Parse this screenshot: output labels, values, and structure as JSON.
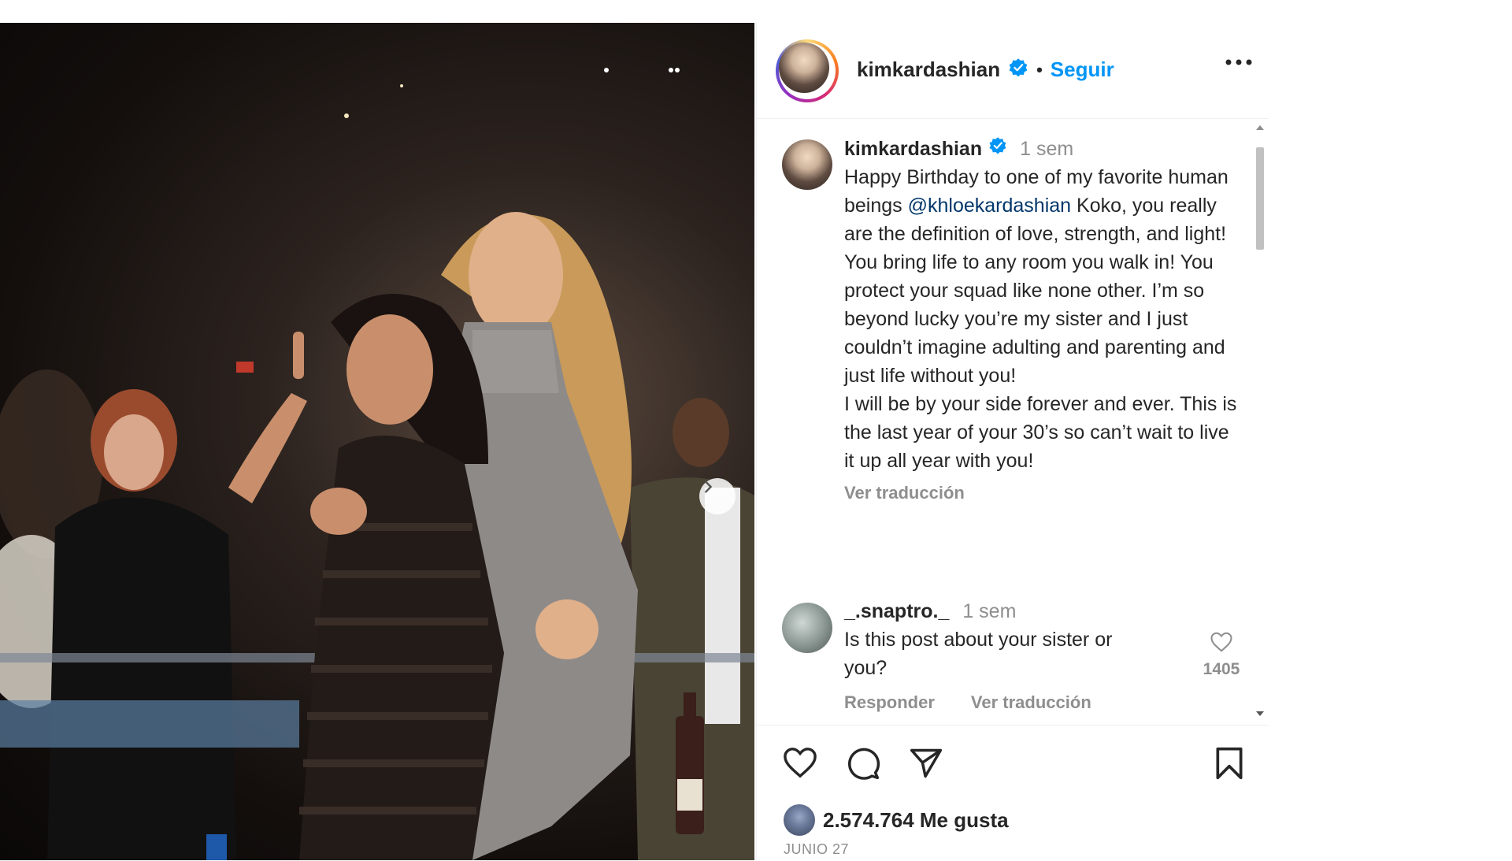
{
  "post": {
    "photo_alt": "",
    "header": {
      "username": "kimkardashian",
      "separator": "•",
      "follow_label": "Seguir"
    },
    "caption": {
      "username": "kimkardashian",
      "time": "1 sem",
      "text_before_mention": "Happy Birthday to one of my favorite human beings ",
      "mention": "@khloekardashian",
      "text_after_mention": " Koko, you really are the definition of love, strength, and light! You bring life to any room you walk in! You protect your squad like none other. I’m so beyond lucky you’re my sister and I just couldn’t imagine adulting and parenting and just life without you!",
      "text_line2": "I will be by your side forever and ever. This is the last year of your 30’s so can’t wait to live it up all year with you!",
      "translate_label": "Ver traducción"
    },
    "comments": [
      {
        "username": "_.snaptro._",
        "time": "1 sem",
        "text": "Is this post about your sister or you?",
        "like_count": "1405",
        "reply_label": "Responder",
        "translate_label": "Ver traducción"
      }
    ],
    "likes_text": "2.574.764 Me gusta",
    "date": "JUNIO 27"
  },
  "colors": {
    "accent": "#0095f6",
    "verified": "#0095f6",
    "mention": "#00376b",
    "muted": "#8e8e8e"
  },
  "icons": {
    "header_more": "more-horizontal-icon",
    "verified": "verified-badge-icon",
    "like": "heart-icon",
    "comment": "comment-icon",
    "share": "send-icon",
    "save": "bookmark-icon",
    "next": "chevron-right-icon"
  }
}
